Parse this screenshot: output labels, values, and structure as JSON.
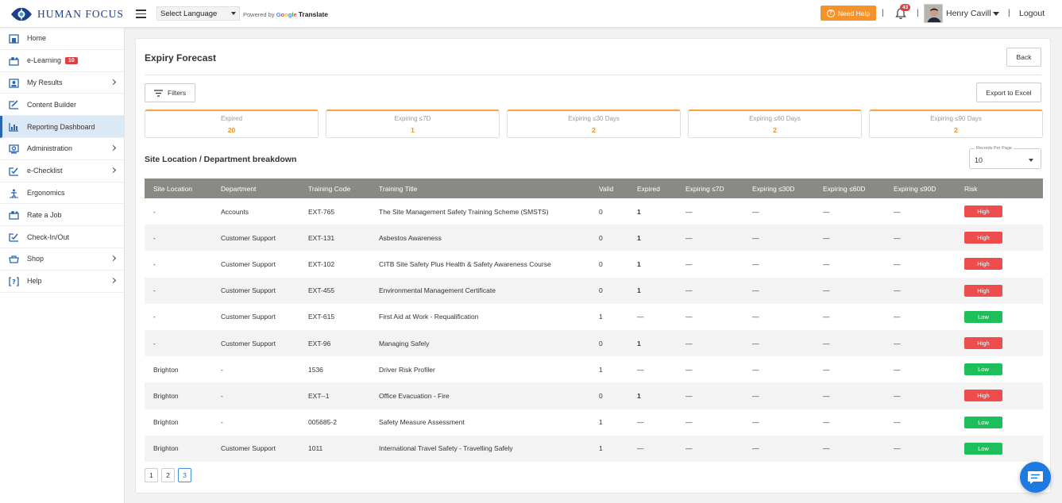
{
  "brand": {
    "name": "HUMAN FOCUS",
    "primary_color": "#1d3f8c"
  },
  "topbar": {
    "language_select": "Select Language",
    "powered_by": "Powered by",
    "google": "Google",
    "translate": "Translate",
    "need_help": "Need Help",
    "notification_count": "43",
    "user_name": "Henry Cavill",
    "logout": "Logout",
    "separator": "|"
  },
  "sidebar": {
    "items": [
      {
        "label": "Home",
        "icon": "home-icon"
      },
      {
        "label": "e-Learning",
        "icon": "elearning-icon",
        "badge": "10"
      },
      {
        "label": "My Results",
        "icon": "results-icon",
        "has_submenu": true
      },
      {
        "label": "Content Builder",
        "icon": "content-builder-icon"
      },
      {
        "label": "Reporting Dashboard",
        "icon": "chart-icon",
        "active": true
      },
      {
        "label": "Administration",
        "icon": "admin-icon",
        "has_submenu": true
      },
      {
        "label": "e-Checklist",
        "icon": "checklist-icon",
        "has_submenu": true
      },
      {
        "label": "Ergonomics",
        "icon": "ergonomics-icon"
      },
      {
        "label": "Rate a Job",
        "icon": "rate-job-icon"
      },
      {
        "label": "Check-In/Out",
        "icon": "checkin-icon"
      },
      {
        "label": "Shop",
        "icon": "shop-icon",
        "has_submenu": true
      },
      {
        "label": "Help",
        "icon": "help-icon",
        "has_submenu": true
      }
    ]
  },
  "page": {
    "title": "Expiry Forecast",
    "back": "Back",
    "filters": "Filters",
    "export": "Export to Excel",
    "section_title": "Site Location / Department breakdown",
    "records_per_page_label": "Records Per Page",
    "records_per_page_value": "10"
  },
  "kpis": [
    {
      "label": "Expired",
      "value": "20"
    },
    {
      "label": "Expiring ≤7D",
      "value": "1"
    },
    {
      "label": "Expiring ≤30 Days",
      "value": "2"
    },
    {
      "label": "Expiring ≤60 Days",
      "value": "2"
    },
    {
      "label": "Expiring ≤90 Days",
      "value": "2"
    }
  ],
  "table": {
    "columns": [
      "Site Location",
      "Department",
      "Training Code",
      "Training Title",
      "Valid",
      "Expired",
      "Expiring ≤7D",
      "Expiring ≤30D",
      "Expiring ≤60D",
      "Expiring ≤90D",
      "Risk"
    ],
    "rows": [
      {
        "site": "-",
        "dept": "Accounts",
        "code": "EXT-765",
        "title": "The Site Management Safety Training Scheme (SMSTS)",
        "valid": "0",
        "expired": "1",
        "e7": "—",
        "e30": "—",
        "e60": "—",
        "e90": "—",
        "risk": "High"
      },
      {
        "site": "-",
        "dept": "Customer Support",
        "code": "EXT-131",
        "title": "Asbestos Awareness",
        "valid": "0",
        "expired": "1",
        "e7": "—",
        "e30": "—",
        "e60": "—",
        "e90": "—",
        "risk": "High"
      },
      {
        "site": "-",
        "dept": "Customer Support",
        "code": "EXT-102",
        "title": "CITB Site Safety Plus Health & Safety Awareness Course",
        "valid": "0",
        "expired": "1",
        "e7": "—",
        "e30": "—",
        "e60": "—",
        "e90": "—",
        "risk": "High"
      },
      {
        "site": "-",
        "dept": "Customer Support",
        "code": "EXT-455",
        "title": "Environmental Management Certificate",
        "valid": "0",
        "expired": "1",
        "e7": "—",
        "e30": "—",
        "e60": "—",
        "e90": "—",
        "risk": "High"
      },
      {
        "site": "-",
        "dept": "Customer Support",
        "code": "EXT-615",
        "title": "First Aid at Work - Requalification",
        "valid": "1",
        "expired": "—",
        "e7": "—",
        "e30": "—",
        "e60": "—",
        "e90": "—",
        "risk": "Low"
      },
      {
        "site": "-",
        "dept": "Customer Support",
        "code": "EXT-96",
        "title": "Managing Safely",
        "valid": "0",
        "expired": "1",
        "e7": "—",
        "e30": "—",
        "e60": "—",
        "e90": "—",
        "risk": "High"
      },
      {
        "site": "Brighton",
        "dept": "-",
        "code": "1536",
        "title": "Driver Risk Profiler",
        "valid": "1",
        "expired": "—",
        "e7": "—",
        "e30": "—",
        "e60": "—",
        "e90": "—",
        "risk": "Low"
      },
      {
        "site": "Brighton",
        "dept": "-",
        "code": "EXT--1",
        "title": "Office Evacuation - Fire",
        "valid": "0",
        "expired": "1",
        "e7": "—",
        "e30": "—",
        "e60": "—",
        "e90": "—",
        "risk": "High"
      },
      {
        "site": "Brighton",
        "dept": "-",
        "code": "005685-2",
        "title": "Safety Measure Assessment",
        "valid": "1",
        "expired": "—",
        "e7": "—",
        "e30": "—",
        "e60": "—",
        "e90": "—",
        "risk": "Low"
      },
      {
        "site": "Brighton",
        "dept": "Customer Support",
        "code": "1011",
        "title": "International Travel Safety - Travelling Safely",
        "valid": "1",
        "expired": "—",
        "e7": "—",
        "e30": "—",
        "e60": "—",
        "e90": "—",
        "risk": "Low"
      }
    ]
  },
  "pagination": {
    "pages": [
      "1",
      "2",
      "3"
    ],
    "current": "3"
  },
  "colors": {
    "accent_orange": "#f6922a",
    "risk_high": "#ef4d4d",
    "risk_low": "#1dbf5a",
    "link_blue": "#2a78c3",
    "header_gray": "#8a8a85"
  }
}
